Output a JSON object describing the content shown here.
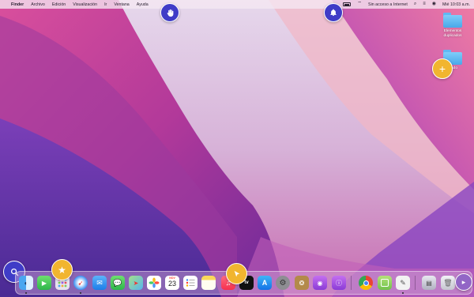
{
  "menubar": {
    "apple": "",
    "app_name": "Finder",
    "menus": [
      "Archivo",
      "Edición",
      "Visualización",
      "Ir",
      "Ventana",
      "Ayuda"
    ],
    "wifi_status": "Sin acceso a Internet",
    "datetime": "Mié 10:03 a.m."
  },
  "desktop": {
    "items": [
      {
        "label": "Elementos duplicados"
      },
      {
        "label": "...ado"
      }
    ]
  },
  "overlay_buttons": {
    "hand": "hand-icon",
    "bell": "bell-icon",
    "plus": "+",
    "search": "search-icon",
    "star": "★",
    "cursor": "cursor-icon"
  },
  "dock": {
    "calendar": {
      "month": "NOV",
      "day": "23"
    },
    "tv_label": "tv",
    "apps": [
      "Finder",
      "FaceTime",
      "Launchpad",
      "Safari",
      "Mail",
      "Mensajes",
      "Mapas",
      "Fotos",
      "Calendario",
      "Recordatorios",
      "Notas",
      "Música",
      "TV",
      "App Store",
      "Preferencias del Sistema",
      "Utilidad",
      "Podcasts",
      "Notas de voz",
      "Chrome",
      "Vista previa",
      "TextEdit",
      "Descargas",
      "Papelera"
    ]
  },
  "colors": {
    "accent_blue": "#3f3cc7",
    "accent_yellow": "#f1b52f"
  }
}
